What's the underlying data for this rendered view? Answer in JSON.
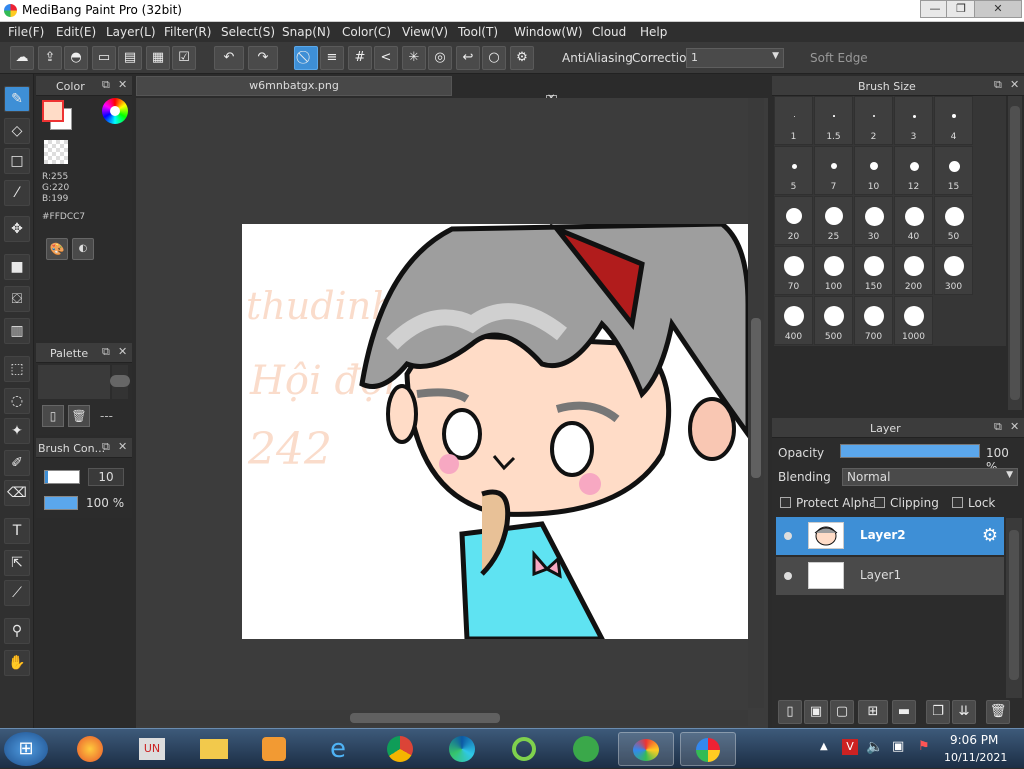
{
  "window": {
    "title": "MediBang Paint Pro (32bit)",
    "minimize": "—",
    "restore": "❐",
    "close": "✕"
  },
  "menu": [
    "File(F)",
    "Edit(E)",
    "Layer(L)",
    "Filter(R)",
    "Select(S)",
    "Snap(N)",
    "Color(C)",
    "View(V)",
    "Tool(T)",
    "Window(W)",
    "Cloud",
    "Help"
  ],
  "toolbar": {
    "antialiasing_label": "AntiAliasing",
    "antialiasing_checked": true,
    "correction_label": "Correction",
    "correction_value": "1",
    "soft_edge_label": "Soft Edge",
    "soft_edge_checked": false
  },
  "color_panel": {
    "title": "Color",
    "r": "R:255",
    "g": "G:220",
    "b": "B:199",
    "hex": "#FFDCC7",
    "primary_color": "#FFDCC7",
    "secondary_color": "#FFFFFF"
  },
  "palette_panel": {
    "title": "Palette",
    "placeholder": "---"
  },
  "brush_control_panel": {
    "title": "Brush Con...",
    "size": "10",
    "opacity": "100 %"
  },
  "document": {
    "tab": "w6mnbatgx.png",
    "watermark_lines": [
      "thudinh",
      "Hội đợi",
      "242"
    ]
  },
  "brush_size_panel": {
    "title": "Brush Size",
    "sizes": [
      "1",
      "1.5",
      "2",
      "3",
      "4",
      "5",
      "7",
      "10",
      "12",
      "15",
      "20",
      "25",
      "30",
      "40",
      "50",
      "70",
      "100",
      "150",
      "200",
      "300",
      "400",
      "500",
      "700",
      "1000"
    ]
  },
  "layer_panel": {
    "title": "Layer",
    "opacity_label": "Opacity",
    "opacity_value": "100 %",
    "opacity": 1.0,
    "blending_label": "Blending",
    "blending_value": "Normal",
    "protect_alpha_label": "Protect Alpha",
    "clipping_label": "Clipping",
    "lock_label": "Lock",
    "layers": [
      {
        "name": "Layer2",
        "selected": true
      },
      {
        "name": "Layer1",
        "selected": false
      }
    ]
  },
  "taskbar": {
    "time": "9:06 PM",
    "date": "10/11/2021",
    "apps": [
      "start-orb",
      "firefox",
      "unikey",
      "file-explorer",
      "media-player",
      "internet-explorer",
      "chrome",
      "edge",
      "app-green-1",
      "app-green-2",
      "paint-palette",
      "medibang"
    ]
  },
  "colors": {
    "accent": "#3E8FD6",
    "panel_bg": "#2C2C2C",
    "canvas_bg": "#3C3C3C",
    "skin": "#FFDCC7",
    "hair_gray": "#9E9E9E",
    "shirt_cyan": "#5FE3F2"
  }
}
